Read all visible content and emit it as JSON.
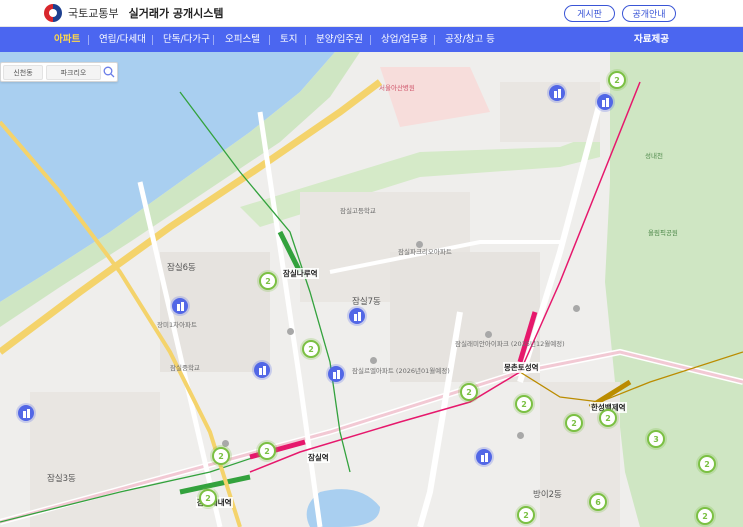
{
  "header": {
    "ministry": "국토교통부",
    "system": "실거래가 공개시스템",
    "board_button": "게시판",
    "notice_button": "공개안내"
  },
  "nav": {
    "items": [
      "아파트",
      "연립/다세대",
      "단독/다가구",
      "오피스텔",
      "토지",
      "분양/입주권",
      "상업/업무용",
      "공장/창고 등"
    ],
    "active": "아파트",
    "data_link": "자료제공"
  },
  "search": {
    "tab1": "신천동",
    "tab2": "파크리오",
    "icon": "search-icon"
  },
  "map": {
    "areas": [
      "잠실6동",
      "잠실3동",
      "방이2동",
      "잠실7동",
      "장미1차아파트",
      "잠실파크리오아파트",
      "잠실르엘아파트 (2026년01월예정)",
      "잠실래미안아이파크 (2025년12월예정)",
      "잠실고등학교",
      "잠실중학교",
      "서울아산병원",
      "올림픽공원",
      "성내천"
    ],
    "stations": [
      "잠실나루역",
      "잠실역",
      "잠실새내역",
      "몽촌토성역",
      "한성백제역"
    ],
    "clusters": [
      "2",
      "2",
      "2",
      "2",
      "2",
      "2",
      "2",
      "2",
      "2",
      "2",
      "6",
      "6",
      "3",
      "2",
      "2",
      "2",
      "2",
      "2"
    ],
    "colors": {
      "line2": "#33a23d",
      "line8": "#e6186c",
      "line9": "#bb8c00",
      "cluster": "#7bc043",
      "pin": "#5267e6"
    }
  }
}
